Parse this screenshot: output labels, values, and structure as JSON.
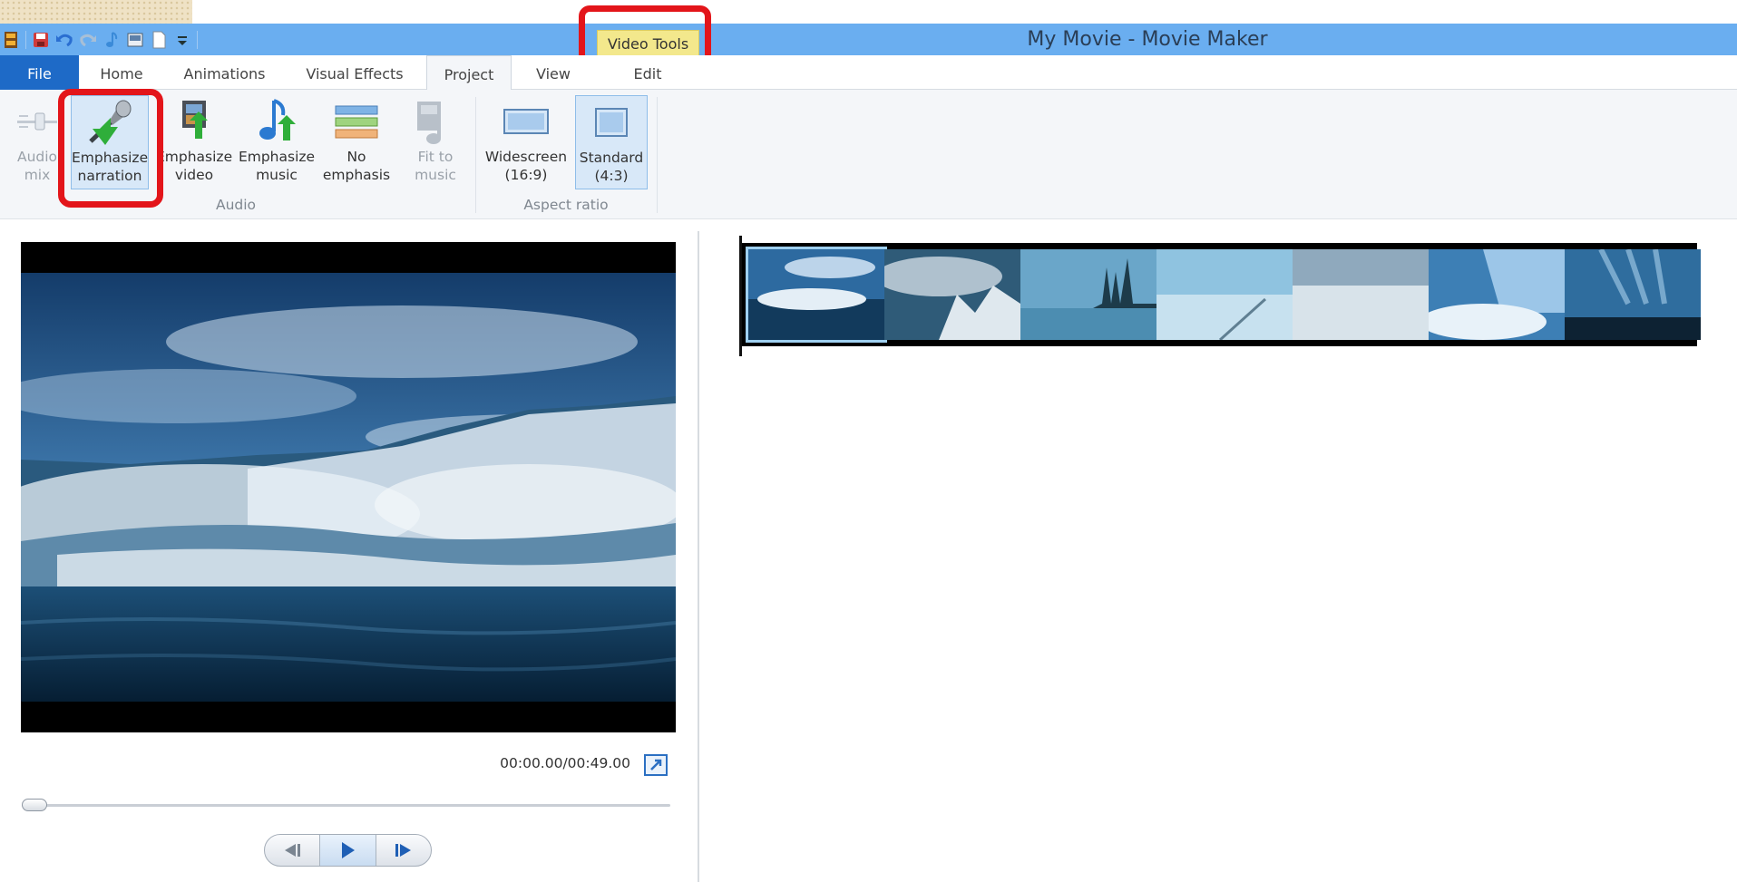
{
  "app": {
    "title": "My Movie - Movie Maker",
    "contextual_tab": "Video Tools"
  },
  "tabs": [
    "File",
    "Home",
    "Animations",
    "Visual Effects",
    "Project",
    "View",
    "Edit"
  ],
  "active_tab": "Project",
  "ribbon": {
    "audio_group_label": "Audio",
    "aspect_group_label": "Aspect ratio",
    "audio_mix": {
      "line1": "Audio",
      "line2": "mix"
    },
    "emphasize_narration": {
      "line1": "Emphasize",
      "line2": "narration"
    },
    "emphasize_video": {
      "line1": "Emphasize",
      "line2": "video"
    },
    "emphasize_music": {
      "line1": "Emphasize",
      "line2": "music"
    },
    "no_emphasis": {
      "line1": "No",
      "line2": "emphasis"
    },
    "fit_to_music": {
      "line1": "Fit to",
      "line2": "music"
    },
    "widescreen": {
      "line1": "Widescreen",
      "line2": "(16:9)"
    },
    "standard": {
      "line1": "Standard",
      "line2": "(4:3)"
    }
  },
  "player": {
    "time": "00:00.00/00:49.00",
    "seek_progress": 0
  },
  "storyboard": {
    "clip_count": 7,
    "selected_clip_index": 0
  },
  "colors": {
    "titlebar": "#6aaef0",
    "file_tab": "#1e6ac7",
    "contextual_tab": "#f3e88c",
    "highlight": "#e3151a"
  },
  "icons": [
    "movie-maker-icon",
    "save-icon",
    "undo-icon",
    "redo-icon",
    "music-note-icon",
    "snapshot-icon",
    "new-project-icon",
    "dropdown-icon",
    "slider-icon",
    "microphone-icon",
    "film-up-arrow-icon",
    "music-up-arrow-icon",
    "no-emphasis-icon",
    "fit-to-music-icon",
    "widescreen-icon",
    "standard-icon",
    "fullscreen-icon",
    "previous-frame-icon",
    "play-icon",
    "next-frame-icon"
  ]
}
